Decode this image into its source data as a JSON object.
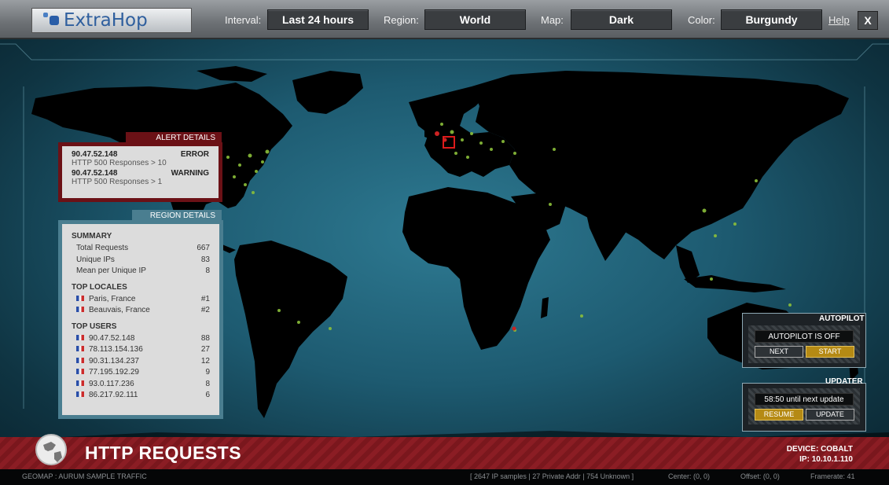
{
  "header": {
    "logo_text": "ExtraHop",
    "interval_label": "Interval:",
    "interval_value": "Last 24 hours",
    "region_label": "Region:",
    "region_value": "World",
    "map_label": "Map:",
    "map_value": "Dark",
    "color_label": "Color:",
    "color_value": "Burgundy",
    "help_label": "Help",
    "close_label": "X"
  },
  "alert_details": {
    "title": "ALERT DETAILS",
    "items": [
      {
        "ip": "90.47.52.148",
        "level": "ERROR",
        "desc": "HTTP 500 Responses > 10"
      },
      {
        "ip": "90.47.52.148",
        "level": "WARNING",
        "desc": "HTTP 500 Responses > 1"
      }
    ]
  },
  "region_details": {
    "title": "REGION DETAILS",
    "summary_title": "SUMMARY",
    "summary": [
      {
        "label": "Total Requests",
        "value": "667"
      },
      {
        "label": "Unique IPs",
        "value": "83"
      },
      {
        "label": "Mean per Unique IP",
        "value": "8"
      }
    ],
    "locales_title": "TOP LOCALES",
    "locales": [
      {
        "label": "Paris, France",
        "value": "#1"
      },
      {
        "label": "Beauvais, France",
        "value": "#2"
      }
    ],
    "users_title": "TOP USERS",
    "users": [
      {
        "label": "90.47.52.148",
        "value": "88"
      },
      {
        "label": "78.113.154.136",
        "value": "27"
      },
      {
        "label": "90.31.134.237",
        "value": "12"
      },
      {
        "label": "77.195.192.29",
        "value": "9"
      },
      {
        "label": "93.0.117.236",
        "value": "8"
      },
      {
        "label": "86.217.92.111",
        "value": "6"
      }
    ]
  },
  "autopilot": {
    "title": "AUTOPILOT",
    "status": "AUTOPILOT IS OFF",
    "next_label": "NEXT",
    "start_label": "START"
  },
  "updater": {
    "title": "UPDATER",
    "status": "58:50 until next update",
    "resume_label": "RESUME",
    "update_label": "UPDATE"
  },
  "banner": {
    "title": "HTTP REQUESTS",
    "device": "DEVICE: COBALT",
    "ip": "IP: 10.10.1.110"
  },
  "footer": {
    "left": "GEOMAP : AURUM SAMPLE TRAFFIC",
    "samples": "[ 2647 IP samples | 27 Private Addr | 754 Unknown ]",
    "center": "Center: (0, 0)",
    "offset": "Offset: (0, 0)",
    "framerate": "Framerate: 41"
  },
  "colors": {
    "burgundy": "#6b1116",
    "ocean": "#2e7a92",
    "gold": "#b58a14"
  }
}
